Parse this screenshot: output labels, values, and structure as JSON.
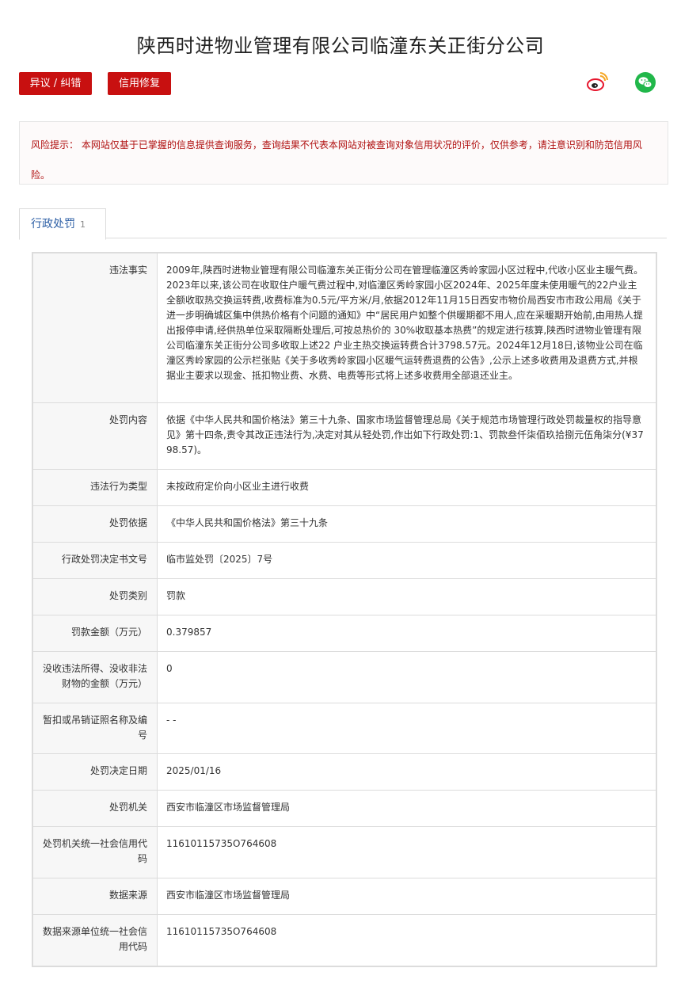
{
  "header": {
    "title": "陕西时进物业管理有限公司临潼东关正街分公司",
    "objection_label": "异议 / 纠错",
    "repair_label": "信用修复"
  },
  "share": {
    "weibo_icon": "weibo-icon",
    "wechat_icon": "wechat-icon",
    "weibo_color": "#e6162d",
    "wechat_color": "#21b74a"
  },
  "risk": {
    "text": "风险提示： 本网站仅基于已掌握的信息提供查询服务，查询结果不代表本网站对被查询对象信用状况的评价，仅供参考，请注意识别和防范信用风险。"
  },
  "tab": {
    "label": "行政处罚",
    "count": "1"
  },
  "rows": [
    {
      "key": "违法事实",
      "value": "2009年,陕西时进物业管理有限公司临潼东关正街分公司在管理临潼区秀岭家园小区过程中,代收小区业主暖气费。2023年以来,该公司在收取住户暖气费过程中,对临潼区秀岭家园小区2024年、2025年度未使用暖气的22户业主全额收取热交换运转费,收费标准为0.5元/平方米/月,依据2012年11月15日西安市物价局西安市市政公用局《关于进一步明确城区集中供热价格有个问题的通知》中“居民用户如整个供暖期都不用人,应在采暖期开始前,由用热人提出报停申请,经供热单位采取隔断处理后,可按总热价的 30%收取基本热费”的规定进行核算,陕西时进物业管理有限公司临潼东关正街分公司多收取上述22 户业主热交换运转费合计3798.57元。2024年12月18日,该物业公司在临潼区秀岭家园的公示栏张贴《关于多收秀岭家园小区暖气运转费退费的公告》,公示上述多收费用及退费方式,并根据业主要求以现金、抵扣物业费、水费、电费等形式将上述多收费用全部退还业主。"
    },
    {
      "key": "处罚内容",
      "value": "依据《中华人民共和国价格法》第三十九条、国家市场监督管理总局《关于规范市场管理行政处罚裁量权的指导意见》第十四条,责令其改正违法行为,决定对其从轻处罚,作出如下行政处罚:1、罚款叁仟柒佰玖拾捌元伍角柒分(¥3798.57)。"
    },
    {
      "key": "违法行为类型",
      "value": "未按政府定价向小区业主进行收费"
    },
    {
      "key": "处罚依据",
      "value": "《中华人民共和国价格法》第三十九条"
    },
    {
      "key": "行政处罚决定书文号",
      "value": "临市监处罚〔2025〕7号"
    },
    {
      "key": "处罚类别",
      "value": "罚款"
    },
    {
      "key": "罚款金额（万元）",
      "value": "0.379857"
    },
    {
      "key": "没收违法所得、没收非法财物的金额（万元）",
      "value": "0"
    },
    {
      "key": "暂扣或吊销证照名称及编号",
      "value": "- -"
    },
    {
      "key": "处罚决定日期",
      "value": "2025/01/16"
    },
    {
      "key": "处罚机关",
      "value": "西安市临潼区市场监督管理局"
    },
    {
      "key": "处罚机关统一社会信用代码",
      "value": "11610115735O764608"
    },
    {
      "key": "数据来源",
      "value": "西安市临潼区市场监督管理局"
    },
    {
      "key": "数据来源单位统一社会信用代码",
      "value": "11610115735O764608"
    }
  ]
}
